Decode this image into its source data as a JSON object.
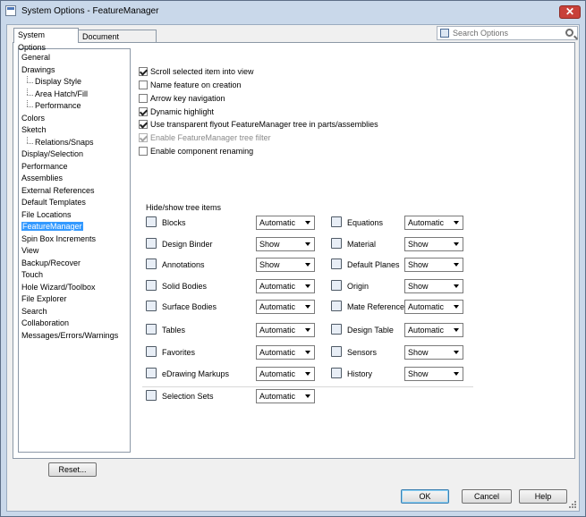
{
  "window": {
    "title": "System Options - FeatureManager",
    "close": "✕"
  },
  "tabs": [
    {
      "label": "System Options",
      "active": true
    },
    {
      "label": "Document Properties",
      "active": false
    }
  ],
  "search": {
    "placeholder": "Search Options"
  },
  "tree": [
    {
      "label": "General",
      "level": 0
    },
    {
      "label": "Drawings",
      "level": 0
    },
    {
      "label": "Display Style",
      "level": 1
    },
    {
      "label": "Area Hatch/Fill",
      "level": 1
    },
    {
      "label": "Performance",
      "level": 1
    },
    {
      "label": "Colors",
      "level": 0
    },
    {
      "label": "Sketch",
      "level": 0
    },
    {
      "label": "Relations/Snaps",
      "level": 1
    },
    {
      "label": "Display/Selection",
      "level": 0
    },
    {
      "label": "Performance",
      "level": 0
    },
    {
      "label": "Assemblies",
      "level": 0
    },
    {
      "label": "External References",
      "level": 0
    },
    {
      "label": "Default Templates",
      "level": 0
    },
    {
      "label": "File Locations",
      "level": 0
    },
    {
      "label": "FeatureManager",
      "level": 0,
      "selected": true
    },
    {
      "label": "Spin Box Increments",
      "level": 0
    },
    {
      "label": "View",
      "level": 0
    },
    {
      "label": "Backup/Recover",
      "level": 0
    },
    {
      "label": "Touch",
      "level": 0
    },
    {
      "label": "Hole Wizard/Toolbox",
      "level": 0
    },
    {
      "label": "File Explorer",
      "level": 0
    },
    {
      "label": "Search",
      "level": 0
    },
    {
      "label": "Collaboration",
      "level": 0
    },
    {
      "label": "Messages/Errors/Warnings",
      "level": 0
    }
  ],
  "checkboxes": [
    {
      "label": "Scroll selected item into view",
      "checked": true,
      "disabled": false
    },
    {
      "label": "Name feature on creation",
      "checked": false,
      "disabled": false
    },
    {
      "label": "Arrow key navigation",
      "checked": false,
      "disabled": false
    },
    {
      "label": "Dynamic highlight",
      "checked": true,
      "disabled": false
    },
    {
      "label": "Use transparent flyout FeatureManager tree in parts/assemblies",
      "checked": true,
      "disabled": false
    },
    {
      "label": "Enable FeatureManager tree filter",
      "checked": true,
      "disabled": true
    },
    {
      "label": "Enable component renaming",
      "checked": false,
      "disabled": false
    }
  ],
  "tree_items_section": {
    "label": "Hide/show tree items"
  },
  "left_items": [
    {
      "label": "Blocks",
      "value": "Automatic",
      "icon": "blocks-icon"
    },
    {
      "label": "Design Binder",
      "value": "Show",
      "icon": "design-binder-icon"
    },
    {
      "label": "Annotations",
      "value": "Show",
      "icon": "annotations-icon"
    },
    {
      "label": "Solid Bodies",
      "value": "Automatic",
      "icon": "solid-bodies-icon"
    },
    {
      "label": "Surface Bodies",
      "value": "Automatic",
      "icon": "surface-bodies-icon"
    },
    {
      "label": "Tables",
      "value": "Automatic",
      "icon": "tables-icon"
    },
    {
      "label": "Favorites",
      "value": "Automatic",
      "icon": "favorites-icon"
    },
    {
      "label": "eDrawing Markups",
      "value": "Automatic",
      "icon": "edrawing-markups-icon"
    },
    {
      "label": "Selection Sets",
      "value": "Automatic",
      "icon": "selection-sets-icon"
    }
  ],
  "right_items": [
    {
      "label": "Equations",
      "value": "Automatic",
      "icon": "equations-icon"
    },
    {
      "label": "Material",
      "value": "Show",
      "icon": "material-icon"
    },
    {
      "label": "Default Planes",
      "value": "Show",
      "icon": "default-planes-icon"
    },
    {
      "label": "Origin",
      "value": "Show",
      "icon": "origin-icon"
    },
    {
      "label": "Mate References",
      "value": "Automatic",
      "icon": "mate-references-icon"
    },
    {
      "label": "Design Table",
      "value": "Automatic",
      "icon": "design-table-icon"
    },
    {
      "label": "Sensors",
      "value": "Show",
      "icon": "sensors-icon"
    },
    {
      "label": "History",
      "value": "Show",
      "icon": "history-icon"
    }
  ],
  "buttons": {
    "reset": "Reset...",
    "ok": "OK",
    "cancel": "Cancel",
    "help": "Help"
  }
}
